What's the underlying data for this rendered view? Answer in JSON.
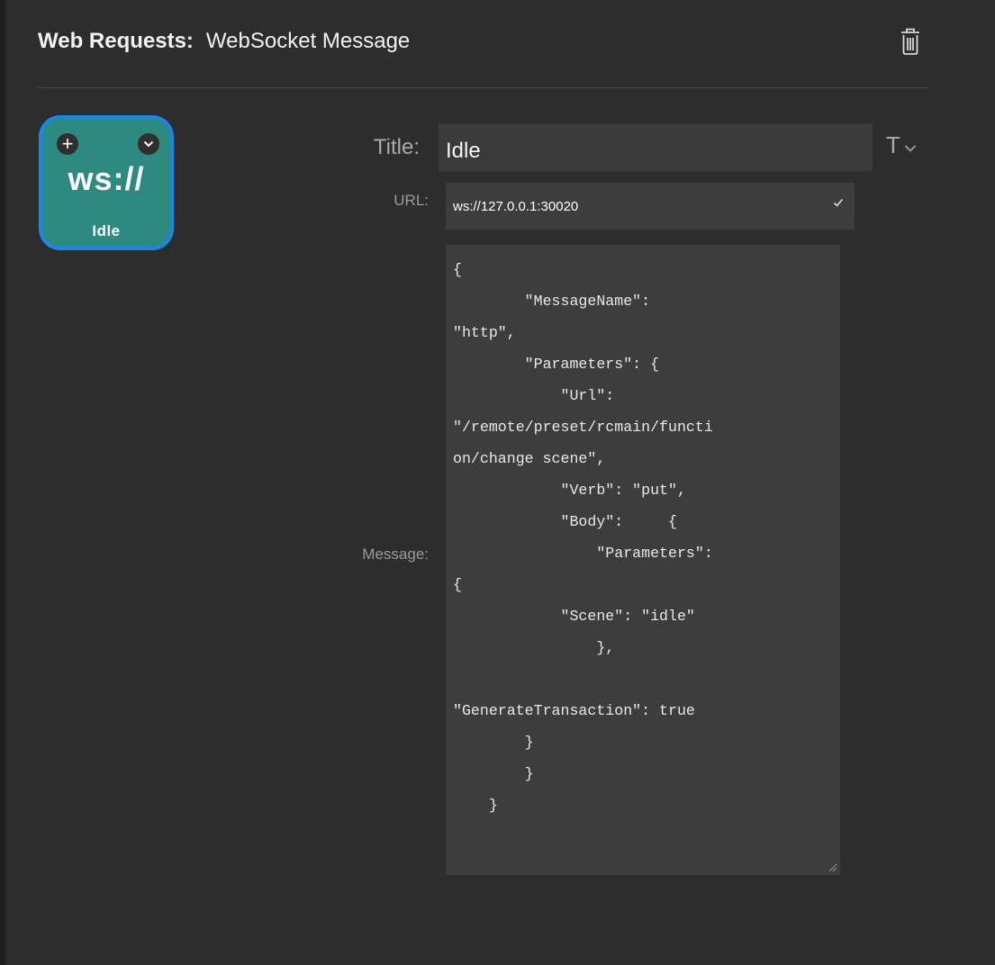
{
  "header": {
    "category": "Web Requests:",
    "action": "WebSocket Message"
  },
  "icons": {
    "delete": "trash-icon",
    "add": "plus-icon",
    "menu": "chevron-down-icon",
    "text_style": "text-style-icon",
    "url_valid": "checkmark-icon"
  },
  "key": {
    "glyph": "ws://",
    "label": "Idle",
    "background_color": "#2d8a80",
    "selected_border_color": "#1a86e8"
  },
  "form": {
    "title_label": "Title:",
    "title_value": "Idle",
    "text_style_glyph": "T",
    "url_label": "URL:",
    "url_value": "ws://127.0.0.1:30020",
    "message_label": "Message:",
    "message_lines": [
      "{",
      "        \"MessageName\":",
      "\"http\",",
      "        \"Parameters\": {",
      "            \"Url\":",
      "\"/remote/preset/rcmain/functi",
      "on/change scene\",",
      "            \"Verb\": \"put\",",
      "            \"Body\":     {",
      "                \"Parameters\":",
      "{",
      "            \"Scene\": \"idle\"",
      "                },",
      "",
      "\"GenerateTransaction\": true",
      "        }",
      "        }",
      "    }"
    ]
  }
}
